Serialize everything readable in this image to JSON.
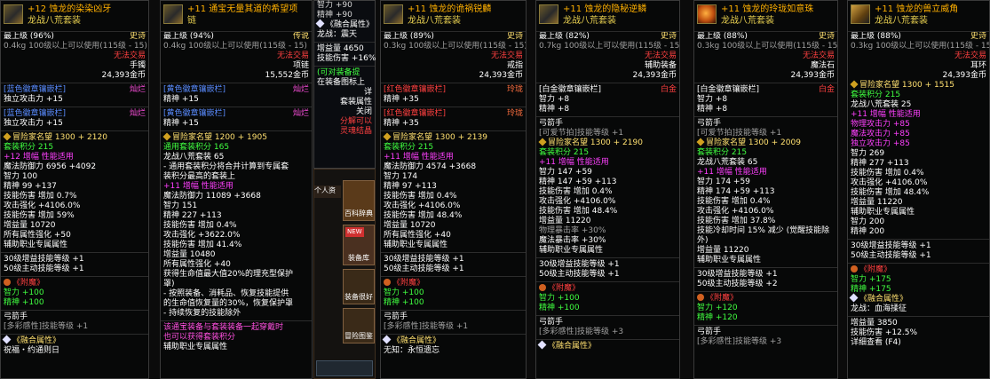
{
  "panels": [
    {
      "name": "+12 蚀龙的染染凶牙",
      "set": "龙战八荒套装",
      "lines": [
        {
          "t": "rare",
          "l": "最上级 (96%)",
          "r": "史诗"
        },
        {
          "t": "gray",
          "v": "0.4kg  100级以上可以使用(115级 - 15)"
        },
        {
          "t": "right red",
          "v": "无法交易"
        },
        {
          "t": "right white",
          "v": "手镯"
        },
        {
          "t": "right white",
          "v": "24,393金币"
        },
        {
          "t": "gap"
        },
        {
          "t": "rare2",
          "l": "[蓝色徽章镶嵌栏]",
          "r": "灿烂"
        },
        {
          "t": "white",
          "v": "  独立攻击力 +15"
        },
        {
          "t": "gap"
        },
        {
          "t": "rare2",
          "l": "[蓝色徽章镶嵌栏]",
          "r": "灿烂"
        },
        {
          "t": "white",
          "v": "  独立攻击力 +15"
        },
        {
          "t": "gap"
        },
        {
          "t": "yellow",
          "v": "冒险家名望 1300 + 2120"
        },
        {
          "t": "green",
          "v": "套装积分 215"
        },
        {
          "t": "magenta",
          "v": "+12 增幅 性能适用"
        },
        {
          "t": "white",
          "v": "魔法防御力 6956 +4092"
        },
        {
          "t": "white",
          "v": "智力 100"
        },
        {
          "t": "white",
          "v": "精神 99 +137"
        },
        {
          "t": "white",
          "v": "技能伤害 增加 0.7%"
        },
        {
          "t": "white",
          "v": "攻击强化 +4106.0%"
        },
        {
          "t": "white",
          "v": "技能伤害 增加 59%"
        },
        {
          "t": "white",
          "v": "增益量 10720"
        },
        {
          "t": "white",
          "v": "所有属性强化 +50"
        },
        {
          "t": "white",
          "v": "辅助职业专属属性"
        },
        {
          "t": "gap"
        },
        {
          "t": "white",
          "v": "30级增益技能等级 +1"
        },
        {
          "t": "white",
          "v": "50级主动技能等级 +1"
        },
        {
          "t": "gap"
        },
        {
          "t": "red",
          "v": "《附魔》"
        },
        {
          "t": "green",
          "v": "智力 +100"
        },
        {
          "t": "green",
          "v": "精神 +100"
        },
        {
          "t": "gap"
        },
        {
          "t": "white",
          "v": "弓箭手"
        },
        {
          "t": "gray",
          "v": "[多彩感性]技能等级 +1"
        },
        {
          "t": "gap"
        },
        {
          "t": "yellow",
          "v": "《融合属性》"
        },
        {
          "t": "white",
          "v": "  祝福・约通则日"
        }
      ]
    },
    {
      "name": "+11 通宝无量其道的希望项",
      "set": "链",
      "lines": [
        {
          "t": "rare",
          "l": "最上级 (94%)",
          "r": "传说"
        },
        {
          "t": "gray",
          "v": "0.4kg  100级以上可以使用(115级 - 15)"
        },
        {
          "t": "right red",
          "v": "无法交易"
        },
        {
          "t": "right white",
          "v": "项链"
        },
        {
          "t": "right white",
          "v": "15,552金币"
        },
        {
          "t": "gap"
        },
        {
          "t": "rare2",
          "l": "[黄色徽章镶嵌栏]",
          "r": "灿烂"
        },
        {
          "t": "white",
          "v": "  精神 +15"
        },
        {
          "t": "gap"
        },
        {
          "t": "rare2",
          "l": "[黄色徽章镶嵌栏]",
          "r": "灿烂"
        },
        {
          "t": "white",
          "v": "  精神 +15"
        },
        {
          "t": "gap"
        },
        {
          "t": "yellow",
          "v": "冒险家名望 1200 + 1905"
        },
        {
          "t": "green",
          "v": "通用套装积分 165"
        },
        {
          "t": "white",
          "v": "  龙战八荒套装 65"
        },
        {
          "t": "white",
          "v": "- 通用套装积分将合并计算到专属套"
        },
        {
          "t": "white",
          "v": "装积分最高的套装上"
        },
        {
          "t": "magenta",
          "v": "+11 增幅 性能适用"
        },
        {
          "t": "white",
          "v": "魔法防御力 11089 +3668"
        },
        {
          "t": "white",
          "v": "智力 151"
        },
        {
          "t": "white",
          "v": "精神 227 +113"
        },
        {
          "t": "white",
          "v": "技能伤害 增加 0.4%"
        },
        {
          "t": "white",
          "v": "攻击强化 +3622.0%"
        },
        {
          "t": "white",
          "v": "技能伤害 增加 41.4%"
        },
        {
          "t": "white",
          "v": "增益量 10480"
        },
        {
          "t": "white",
          "v": "所有属性强化 +40"
        },
        {
          "t": "white",
          "v": "获得生命值最大值20%的理充型保护"
        },
        {
          "t": "white",
          "v": "罩)"
        },
        {
          "t": "white",
          "v": "- 按照装备、消耗品、恢复技能提供"
        },
        {
          "t": "white",
          "v": "的生命值恢复量的30%，恢复保护罩"
        },
        {
          "t": "white",
          "v": "- 持续恢复的技能除外"
        },
        {
          "t": "gap"
        },
        {
          "t": "purple",
          "v": "该通宝装备与套装装备一起穿戴时"
        },
        {
          "t": "purple",
          "v": "也可以获得套装积分"
        },
        {
          "t": "white",
          "v": "辅助职业专属属性"
        }
      ]
    },
    {
      "name": "+11 蚀龙的诡祸锐麟",
      "set": "龙战八荒套装",
      "lines": [
        {
          "t": "rare",
          "l": "最上级 (89%)",
          "r": "史诗"
        },
        {
          "t": "gray",
          "v": "0.3kg  100级以上可以使用(115级 - 15)"
        },
        {
          "t": "right red",
          "v": "无法交易"
        },
        {
          "t": "right white",
          "v": "戒指"
        },
        {
          "t": "right white",
          "v": "24,393金币"
        },
        {
          "t": "gap"
        },
        {
          "t": "rare3",
          "l": "[红色徽章镶嵌栏]",
          "r": "玲珑"
        },
        {
          "t": "white",
          "v": "  精神 +35"
        },
        {
          "t": "gap"
        },
        {
          "t": "rare3",
          "l": "[红色徽章镶嵌栏]",
          "r": "玲珑"
        },
        {
          "t": "white",
          "v": "  精神 +35"
        },
        {
          "t": "gap"
        },
        {
          "t": "yellow",
          "v": "冒险家名望 1300 + 2139"
        },
        {
          "t": "green",
          "v": "套装积分 215"
        },
        {
          "t": "magenta",
          "v": "+11 增幅 性能适用"
        },
        {
          "t": "white",
          "v": "魔法防御力 4574 +3668"
        },
        {
          "t": "white",
          "v": "智力 174"
        },
        {
          "t": "white",
          "v": "精神 97 +113"
        },
        {
          "t": "white",
          "v": "技能伤害 增加 0.4%"
        },
        {
          "t": "white",
          "v": "攻击强化 +4106.0%"
        },
        {
          "t": "white",
          "v": "技能伤害 增加 48.4%"
        },
        {
          "t": "white",
          "v": "增益量 10720"
        },
        {
          "t": "white",
          "v": "所有属性强化 +40"
        },
        {
          "t": "white",
          "v": "辅助职业专属属性"
        },
        {
          "t": "gap"
        },
        {
          "t": "white",
          "v": "30级增益技能等级 +1"
        },
        {
          "t": "white",
          "v": "50级主动技能等级 +1"
        },
        {
          "t": "gap"
        },
        {
          "t": "red",
          "v": "《附魔》"
        },
        {
          "t": "green",
          "v": "智力 +100"
        },
        {
          "t": "green",
          "v": "精神 +100"
        },
        {
          "t": "gap"
        },
        {
          "t": "white",
          "v": "弓箭手"
        },
        {
          "t": "gray",
          "v": "[多彩感性]技能等级 +1"
        },
        {
          "t": "gap"
        },
        {
          "t": "yellow",
          "v": "《融合属性》"
        },
        {
          "t": "white",
          "v": "  无知：永恒遗忘"
        }
      ]
    },
    {
      "name": "+11 蚀龙的隐秘逆鳞",
      "set": "龙战八荒套装",
      "lines": [
        {
          "t": "rare",
          "l": "最上级 (82%)",
          "r": "史诗"
        },
        {
          "t": "gray",
          "v": "0.7kg  100级以上可以使用(115级 - 15)"
        },
        {
          "t": "right red",
          "v": "无法交易"
        },
        {
          "t": "right white",
          "v": "辅助装备"
        },
        {
          "t": "right white",
          "v": "24,393金币"
        },
        {
          "t": "gap"
        },
        {
          "t": "rare4",
          "l": "[白金徽章镶嵌栏]",
          "r": "白金"
        },
        {
          "t": "white",
          "v": "  智力 +8"
        },
        {
          "t": "white",
          "v": "  精神 +8"
        },
        {
          "t": "gap"
        },
        {
          "t": "white",
          "v": "弓箭手"
        },
        {
          "t": "gray",
          "v": "  [可爱节拍]技能等级 +1"
        },
        {
          "t": "yellow",
          "v": "冒险家名望 1300 + 2190"
        },
        {
          "t": "green",
          "v": "套装积分 215"
        },
        {
          "t": "magenta",
          "v": "+11 增幅 性能适用"
        },
        {
          "t": "white",
          "v": "智力 147 +59"
        },
        {
          "t": "white",
          "v": "精神 147 +59 +113"
        },
        {
          "t": "white",
          "v": "技能伤害 增加 0.4%"
        },
        {
          "t": "white",
          "v": "攻击强化 +4106.0%"
        },
        {
          "t": "white",
          "v": "技能伤害 增加 48.4%"
        },
        {
          "t": "white",
          "v": "增益量 11220"
        },
        {
          "t": "gray",
          "v": "物理暴击率 +30%"
        },
        {
          "t": "white",
          "v": "魔法暴击率 +30%"
        },
        {
          "t": "white",
          "v": "辅助职业专属属性"
        },
        {
          "t": "gap"
        },
        {
          "t": "white",
          "v": "30级增益技能等级 +1"
        },
        {
          "t": "white",
          "v": "50级主动技能等级 +1"
        },
        {
          "t": "gap"
        },
        {
          "t": "red",
          "v": "《附魔》"
        },
        {
          "t": "green",
          "v": "智力 +100"
        },
        {
          "t": "green",
          "v": "精神 +100"
        },
        {
          "t": "gap"
        },
        {
          "t": "white",
          "v": "弓箭手"
        },
        {
          "t": "gray",
          "v": "[多彩感性]技能等级 +3"
        },
        {
          "t": "gap"
        },
        {
          "t": "yellow",
          "v": "《融合属性》"
        }
      ]
    },
    {
      "name": "+11 蚀龙的玲珑如意珠",
      "set": "龙战八荒套装",
      "lines": [
        {
          "t": "rare",
          "l": "最上级 (88%)",
          "r": "史诗"
        },
        {
          "t": "gray",
          "v": "0.3kg  100级以上可以使用(115级 - 15)"
        },
        {
          "t": "right red",
          "v": "无法交易"
        },
        {
          "t": "right white",
          "v": "魔法石"
        },
        {
          "t": "right white",
          "v": "24,393金币"
        },
        {
          "t": "gap"
        },
        {
          "t": "rare4",
          "l": "[白金徽章镶嵌栏]",
          "r": "白金"
        },
        {
          "t": "white",
          "v": "  智力 +8"
        },
        {
          "t": "white",
          "v": "  精神 +8"
        },
        {
          "t": "gap"
        },
        {
          "t": "white",
          "v": "弓箭手"
        },
        {
          "t": "gray",
          "v": "  [可爱节拍]技能等级 +1"
        },
        {
          "t": "yellow",
          "v": "冒险家名望 1300 + 2009"
        },
        {
          "t": "green",
          "v": "套装积分 215"
        },
        {
          "t": "white",
          "v": "  龙战八荒套装 65"
        },
        {
          "t": "magenta",
          "v": "+11 增幅 性能适用"
        },
        {
          "t": "white",
          "v": "智力 174 +59"
        },
        {
          "t": "white",
          "v": "精神 174 +59 +113"
        },
        {
          "t": "white",
          "v": "技能伤害 增加 0.4%"
        },
        {
          "t": "white",
          "v": "攻击强化 +4106.0%"
        },
        {
          "t": "white",
          "v": "技能伤害 增加 37.8%"
        },
        {
          "t": "white",
          "v": "技能冷却时间 15% 减少 (觉醒技能除"
        },
        {
          "t": "white",
          "v": "外)"
        },
        {
          "t": "white",
          "v": "增益量 11220"
        },
        {
          "t": "white",
          "v": "辅助职业专属属性"
        },
        {
          "t": "gap"
        },
        {
          "t": "white",
          "v": "30级增益技能等级 +1"
        },
        {
          "t": "white",
          "v": "50级主动技能等级 +2"
        },
        {
          "t": "gap"
        },
        {
          "t": "red",
          "v": "《附魔》"
        },
        {
          "t": "green",
          "v": "智力 +120"
        },
        {
          "t": "green",
          "v": "精神 +120"
        },
        {
          "t": "gap"
        },
        {
          "t": "white",
          "v": "弓箭手"
        },
        {
          "t": "gray",
          "v": "[多彩感性]技能等级 +3"
        }
      ]
    },
    {
      "name": "+11 蚀龙的兽立威角",
      "set": "龙战八荒套装",
      "lines": [
        {
          "t": "rare",
          "l": "最上级 (88%)",
          "r": "史诗"
        },
        {
          "t": "gray",
          "v": "0.3kg  100级以上可以使用(115级 - 15)"
        },
        {
          "t": "right red",
          "v": "无法交易"
        },
        {
          "t": "right white",
          "v": "耳环"
        },
        {
          "t": "right white",
          "v": "24,393金币"
        },
        {
          "t": "yellow",
          "v": "冒险家名望 1300 + 1515"
        },
        {
          "t": "green",
          "v": "套装积分 215"
        },
        {
          "t": "white",
          "v": "  龙战八荒套装 25"
        },
        {
          "t": "magenta",
          "v": "+11 增幅 性能适用"
        },
        {
          "t": "magenta",
          "v": "物理攻击力 +85"
        },
        {
          "t": "magenta",
          "v": "魔法攻击力 +85"
        },
        {
          "t": "magenta",
          "v": "独立攻击力 +85"
        },
        {
          "t": "white",
          "v": "智力 269"
        },
        {
          "t": "white",
          "v": "精神 277 +113"
        },
        {
          "t": "white",
          "v": "技能伤害 增加 0.4%"
        },
        {
          "t": "white",
          "v": "攻击强化 +4106.0%"
        },
        {
          "t": "white",
          "v": "技能伤害 增加 48.4%"
        },
        {
          "t": "white",
          "v": "增益量 11220"
        },
        {
          "t": "white",
          "v": "辅助职业专属属性"
        },
        {
          "t": "white",
          "v": "智力 200"
        },
        {
          "t": "white",
          "v": "精神 200"
        },
        {
          "t": "gap"
        },
        {
          "t": "white",
          "v": "30级增益技能等级 +1"
        },
        {
          "t": "white",
          "v": "50级主动技能等级 +1"
        },
        {
          "t": "gap"
        },
        {
          "t": "red",
          "v": "《附魔》"
        },
        {
          "t": "green",
          "v": "智力 +175"
        },
        {
          "t": "green",
          "v": "精神 +175"
        },
        {
          "t": "yellow",
          "v": "《融合属性》"
        },
        {
          "t": "white",
          "v": "  龙战：血海揉征"
        },
        {
          "t": "gap"
        },
        {
          "t": "white",
          "v": "增益量 3850"
        },
        {
          "t": "white",
          "v": "技能伤害 +12.5%"
        },
        {
          "t": "white",
          "v": "  详细查看 (F4)"
        }
      ]
    }
  ],
  "overlay": {
    "stats": [
      "智力 +90",
      "精神 +90"
    ],
    "fusion": "《融合属性》",
    "fusion_name": "龙战：震天",
    "boost": "增益量 4650",
    "crit": "技能伤害 +16%",
    "lines": [
      "(可对装备提",
      "在装备图标上"
    ],
    "lines2": [
      "详",
      "套装属性",
      "关闭",
      "分解可以",
      "灵魂结晶"
    ]
  },
  "menu": {
    "items": [
      "个人资",
      "百科辞典",
      "NEW",
      "装备库",
      "装备很好",
      "冒险图鉴"
    ]
  }
}
